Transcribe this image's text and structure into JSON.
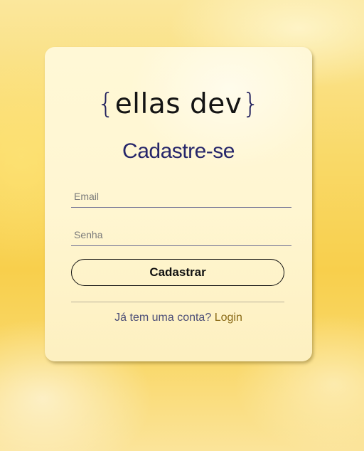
{
  "brand": {
    "brace_open": "{",
    "name": "ellas dev",
    "brace_close": "}"
  },
  "form": {
    "title": "Cadastre-se",
    "email_placeholder": "Email",
    "email_value": "",
    "password_placeholder": "Senha",
    "password_value": "",
    "submit_label": "Cadastrar"
  },
  "footer": {
    "prompt": "Já tem uma conta?",
    "login_label": "Login"
  },
  "colors": {
    "brand_navy": "#26266a",
    "login_link": "#8a6a16",
    "card_background": "#fff6d2",
    "page_background": "#f8cf4c"
  }
}
